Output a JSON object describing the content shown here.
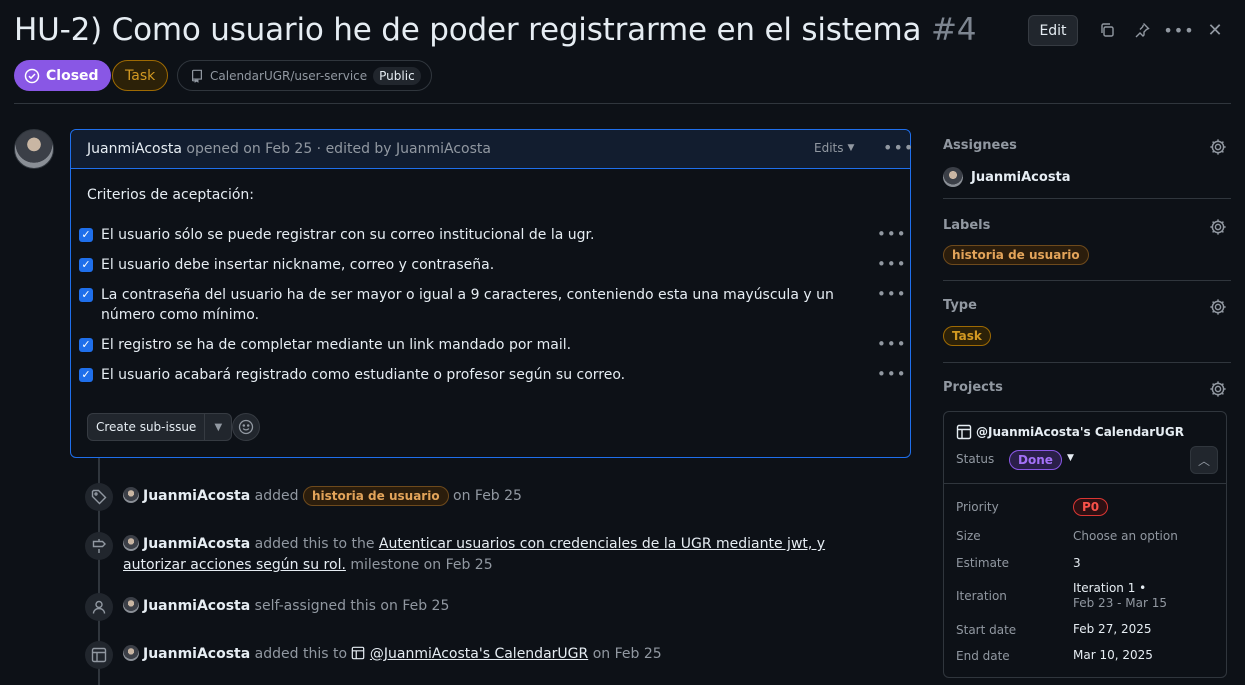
{
  "issue": {
    "title": "HU-2) Como usuario he de poder registrarme en el sistema",
    "number": "#4",
    "state": "Closed",
    "type": "Task",
    "repo": "CalendarUGR/user-service",
    "visibility": "Public",
    "edit_label": "Edit"
  },
  "comment": {
    "author": "JuanmiAcosta",
    "meta": "opened on Feb 25 · edited by JuanmiAcosta",
    "edits_label": "Edits",
    "criteria_heading": "Criterios de aceptación:",
    "tasks": [
      {
        "text": "El usuario sólo se puede registrar con su correo institucional de la ugr.",
        "checked": true
      },
      {
        "text": "El usuario debe insertar nickname, correo y contraseña.",
        "checked": true
      },
      {
        "text": "La contraseña del usuario ha de ser mayor o igual a 9 caracteres, conteniendo esta una mayúscula y un número como mínimo.",
        "checked": true
      },
      {
        "text": "El registro se ha de completar mediante un link mandado por mail.",
        "checked": true
      },
      {
        "text": "El usuario acabará registrado como estudiante o profesor según su correo.",
        "checked": true
      }
    ],
    "sub_issue_label": "Create sub-issue"
  },
  "timeline": [
    {
      "actor": "JuanmiAcosta",
      "pre": "added",
      "label": "historia de usuario",
      "post": "on Feb 25"
    },
    {
      "actor": "JuanmiAcosta",
      "pre": "added this to the",
      "link": "Autenticar usuarios con credenciales de la UGR mediante jwt, y autorizar acciones según su rol.",
      "post": "milestone on Feb 25"
    },
    {
      "actor": "JuanmiAcosta",
      "pre": "self-assigned this on Feb 25"
    },
    {
      "actor": "JuanmiAcosta",
      "pre": "added this to",
      "link": "@JuanmiAcosta's CalendarUGR",
      "post": "on Feb 25"
    }
  ],
  "sidebar": {
    "assignees_heading": "Assignees",
    "assignee": "JuanmiAcosta",
    "labels_heading": "Labels",
    "label": "historia de usuario",
    "type_heading": "Type",
    "type": "Task",
    "projects_heading": "Projects",
    "project": {
      "name": "@JuanmiAcosta's CalendarUGR",
      "status_label": "Status",
      "status": "Done",
      "fields": {
        "priority_label": "Priority",
        "priority": "P0",
        "size_label": "Size",
        "size": "Choose an option",
        "estimate_label": "Estimate",
        "estimate": "3",
        "iteration_label": "Iteration",
        "iteration": "Iteration 1 •",
        "iteration_range": "Feb 23 - Mar 15",
        "start_label": "Start date",
        "start": "Feb 27, 2025",
        "end_label": "End date",
        "end": "Mar 10, 2025"
      }
    }
  }
}
